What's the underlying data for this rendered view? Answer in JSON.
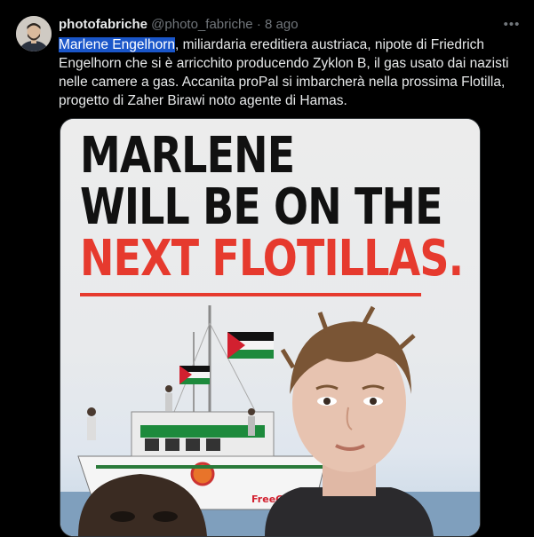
{
  "tweet": {
    "display_name": "photofabriche",
    "handle": "@photo_fabriche",
    "separator": "·",
    "age": "8 ago",
    "more_label": "•••",
    "text_highlight": "Marlene Engelhorn",
    "text_rest": ", miliardaria ereditiera austriaca, nipote di Friedrich Engelhorn che si è arricchito producendo Zyklon B, il gas usato dai nazisti nelle camere a gas. Accanita proPal si imbarcherà nella prossima Flotilla, progetto di Zaher Birawi noto agente di Hamas."
  },
  "media": {
    "headline_line1": "MARLENE",
    "headline_line2": "WILL BE ON THE",
    "headline_line3": "NEXT FLOTILLAS.",
    "boat_sign": "FreeGAZA",
    "headline_color": "#111111",
    "accent_color": "#e63a2e"
  },
  "colors": {
    "background": "#000000",
    "text": "#e7e9ea",
    "muted": "#71767b",
    "selection": "#1a56c9"
  }
}
